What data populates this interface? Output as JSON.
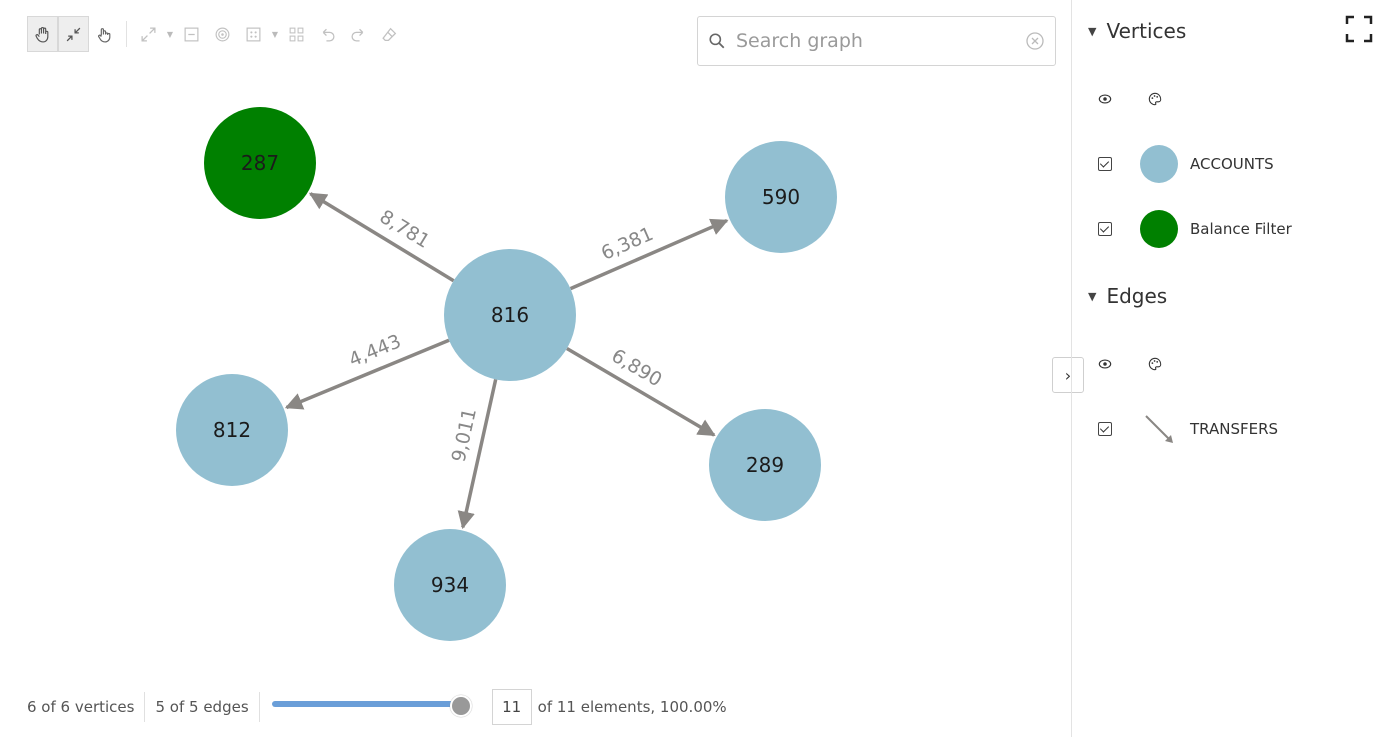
{
  "toolbar": {
    "buttons": [
      "pan",
      "collapse",
      "select",
      "fit",
      "minimize",
      "focus",
      "layout",
      "grid",
      "undo",
      "redo",
      "erase"
    ]
  },
  "search": {
    "placeholder": "Search graph",
    "value": ""
  },
  "graph": {
    "nodes": [
      {
        "id": "816",
        "label": "816",
        "color": "#92bfd1"
      },
      {
        "id": "287",
        "label": "287",
        "color": "#008000"
      },
      {
        "id": "590",
        "label": "590",
        "color": "#92bfd1"
      },
      {
        "id": "812",
        "label": "812",
        "color": "#92bfd1"
      },
      {
        "id": "289",
        "label": "289",
        "color": "#92bfd1"
      },
      {
        "id": "934",
        "label": "934",
        "color": "#92bfd1"
      }
    ],
    "edges": [
      {
        "from": "816",
        "to": "287",
        "label": "8,781"
      },
      {
        "from": "816",
        "to": "590",
        "label": "6,381"
      },
      {
        "from": "816",
        "to": "812",
        "label": "4,443"
      },
      {
        "from": "816",
        "to": "289",
        "label": "6,890"
      },
      {
        "from": "816",
        "to": "934",
        "label": "9,011"
      }
    ],
    "edge_color": "#8a8784"
  },
  "footer": {
    "vertices": "6 of 6 vertices",
    "edges": "5 of 5 edges",
    "slider_fraction": 1.0,
    "count": "11",
    "summary": "of 11 elements, 100.00%"
  },
  "sidebar": {
    "vertices_title": "Vertices",
    "edges_title": "Edges",
    "vertex_legend": [
      {
        "label": "ACCOUNTS",
        "color": "#92bfd1",
        "checked": true
      },
      {
        "label": "Balance Filter",
        "color": "#008000",
        "checked": true
      }
    ],
    "edge_legend": [
      {
        "label": "TRANSFERS",
        "color": "#8a8784",
        "checked": true
      }
    ]
  }
}
